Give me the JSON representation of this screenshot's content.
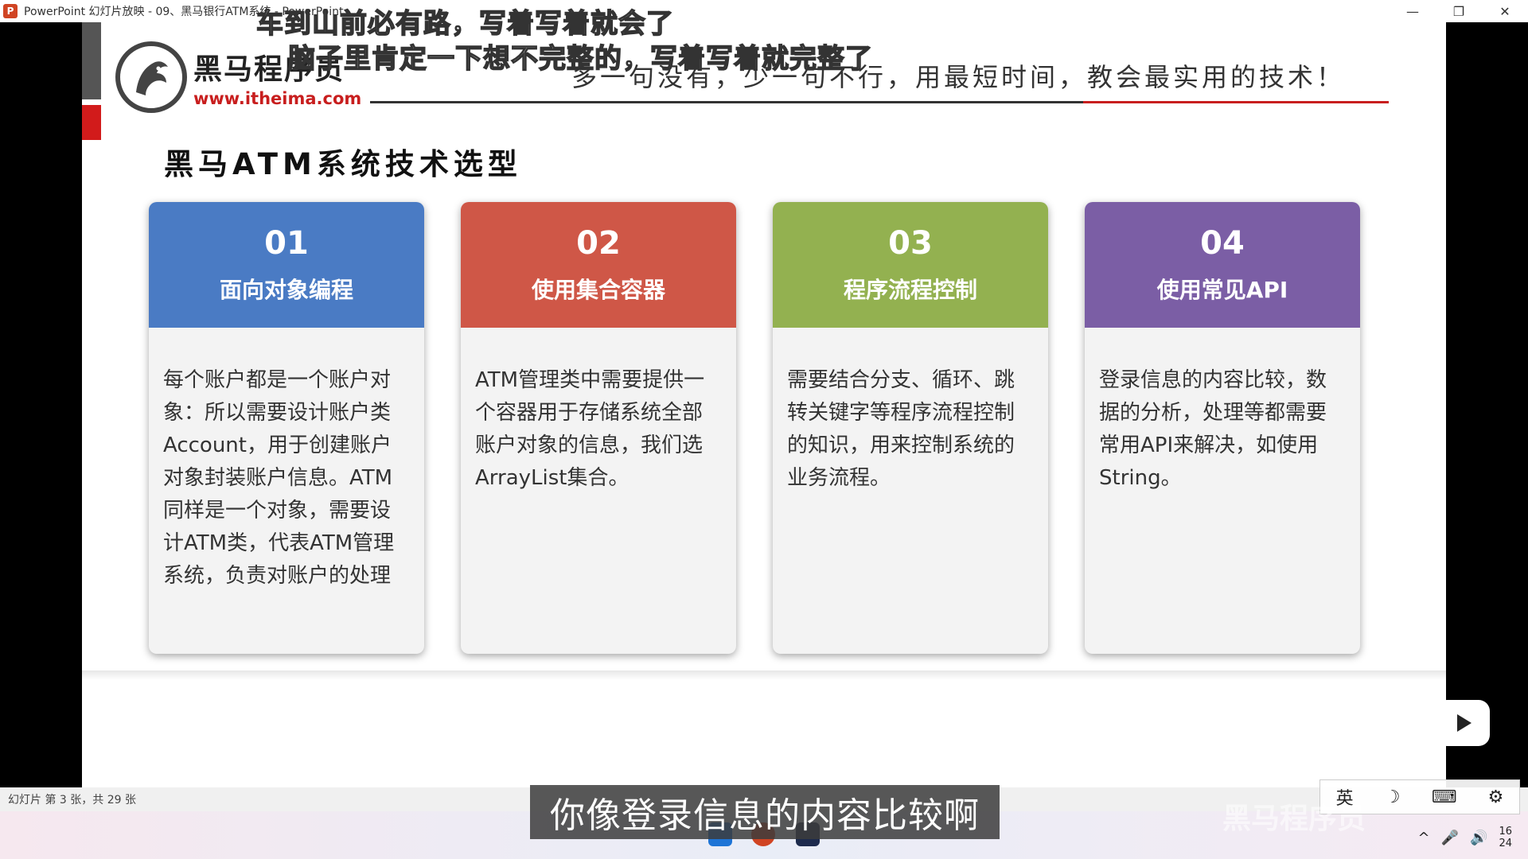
{
  "window": {
    "title": "PowerPoint 幻灯片放映  -  09、黑马银行ATM系统 - PowerPoint",
    "app_icon": "P",
    "minimize": "—",
    "restore": "❐",
    "close": "✕"
  },
  "overlay_subtitles": {
    "line1": "车到山前必有路，写着写着就会了",
    "line2": "脑子里肯定一下想不完整的，写着写着就完整了"
  },
  "slide": {
    "logo": {
      "name": "黑马程序员",
      "url": "www.itheima.com"
    },
    "slogan": "多一句没有，少一句不行，用最短时间，教会最实用的技术！",
    "title": "黑马ATM系统技术选型",
    "cards": [
      {
        "num": "01",
        "label": "面向对象编程",
        "color": "#4a7bc4",
        "body": "每个账户都是一个账户对象：所以需要设计账户类Account，用于创建账户对象封装账户信息。ATM同样是一个对象，需要设计ATM类，代表ATM管理系统，负责对账户的处理"
      },
      {
        "num": "02",
        "label": "使用集合容器",
        "color": "#cf5747",
        "body": "ATM管理类中需要提供一个容器用于存储系统全部账户对象的信息，我们选ArrayList集合。"
      },
      {
        "num": "03",
        "label": "程序流程控制",
        "color": "#93b150",
        "body": "需要结合分支、循环、跳转关键字等程序流程控制的知识，用来控制系统的业务流程。"
      },
      {
        "num": "04",
        "label": "使用常见API",
        "color": "#7b5ea5",
        "body": "登录信息的内容比较，数据的分析，处理等都需要常用API来解决，如使用String。"
      }
    ]
  },
  "caption": "你像登录信息的内容比较啊",
  "status_bar": {
    "text": "幻灯片 第 3 张，共 29 张"
  },
  "ime": {
    "lang": "英",
    "moon": "☽",
    "keyboard": "⌨",
    "settings": "⚙"
  },
  "tray": {
    "clock_line1": "16",
    "clock_line2": "24",
    "up": "^",
    "mic": "🎤",
    "volume": "🔊"
  },
  "watermark": "黑马程序员",
  "colors": {
    "brand_red": "#c81e1e",
    "card1": "#4a7bc4",
    "card2": "#cf5747",
    "card3": "#93b150",
    "card4": "#7b5ea5"
  }
}
